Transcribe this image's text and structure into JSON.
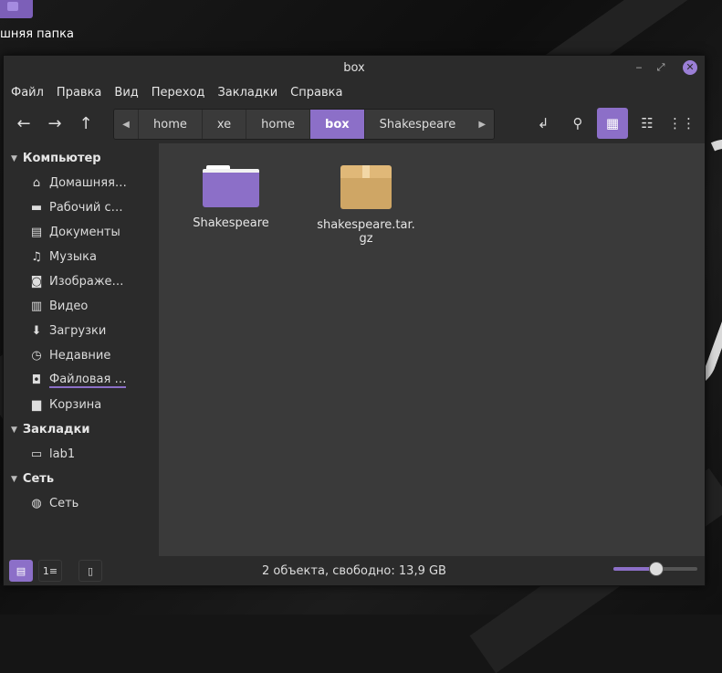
{
  "desktop": {
    "icon_label": "шняя папка"
  },
  "window": {
    "title": "box",
    "controls": {
      "minimize": "‒",
      "maximize": "⤢",
      "close": "✕"
    }
  },
  "menu": [
    "Файл",
    "Правка",
    "Вид",
    "Переход",
    "Закладки",
    "Справка"
  ],
  "toolbar": {
    "back": "←",
    "forward": "→",
    "up": "↑",
    "path_prev": "◀",
    "path_next": "▶",
    "path": [
      "home",
      "xe",
      "home",
      "box",
      "Shakespeare"
    ],
    "active_crumb": 3,
    "toggle_location": "↲",
    "search": "🔍",
    "view_icons": "▦",
    "view_list": "☷",
    "view_compact": "⋮⋮"
  },
  "sidebar": {
    "sections": [
      {
        "title": "Компьютер",
        "items": [
          {
            "label": "Домашняя…",
            "icon": "home-icon",
            "glyph": "⌂"
          },
          {
            "label": "Рабочий с…",
            "icon": "desktop-icon",
            "glyph": "▬"
          },
          {
            "label": "Документы",
            "icon": "document-icon",
            "glyph": "▤"
          },
          {
            "label": "Музыка",
            "icon": "music-icon",
            "glyph": "♫"
          },
          {
            "label": "Изображе…",
            "icon": "camera-icon",
            "glyph": "◙"
          },
          {
            "label": "Видео",
            "icon": "film-icon",
            "glyph": "▥"
          },
          {
            "label": "Загрузки",
            "icon": "download-icon",
            "glyph": "⬇"
          },
          {
            "label": "Недавние",
            "icon": "clock-icon",
            "glyph": "◷"
          },
          {
            "label": "Файловая …",
            "icon": "drive-icon",
            "glyph": "◘"
          },
          {
            "label": "Корзина",
            "icon": "trash-icon",
            "glyph": "▆"
          }
        ]
      },
      {
        "title": "Закладки",
        "items": [
          {
            "label": "lab1",
            "icon": "bookmark-folder-icon",
            "glyph": "▭"
          }
        ]
      },
      {
        "title": "Сеть",
        "items": [
          {
            "label": "Сеть",
            "icon": "network-icon",
            "glyph": "◍"
          }
        ]
      }
    ]
  },
  "files": [
    {
      "name": "Shakespeare",
      "type": "folder"
    },
    {
      "name": "shakespeare.tar.\ngz",
      "type": "archive"
    }
  ],
  "status": {
    "text": "2 объекта, свободно: 13,9 GB",
    "zoom_fraction": 0.5,
    "btn_places": "▤",
    "btn_tree": "1≡",
    "btn_hide": "▯"
  },
  "colors": {
    "accent": "#8c6fc8",
    "folder": "#8c6fc8",
    "archive": "#cfa665"
  }
}
